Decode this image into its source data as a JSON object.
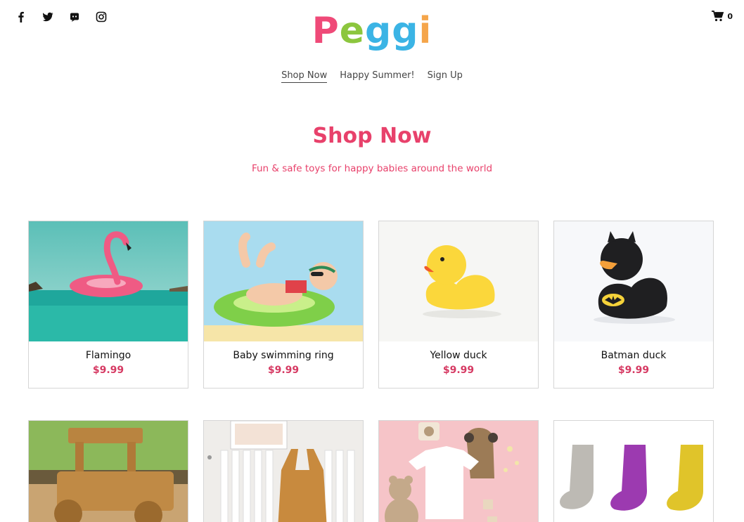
{
  "header": {
    "social_icons": [
      "facebook-icon",
      "twitter-icon",
      "discord-icon",
      "instagram-icon"
    ],
    "logo_letters": [
      {
        "char": "P",
        "color": "#ef4a78"
      },
      {
        "char": "e",
        "color": "#8cc63e"
      },
      {
        "char": "g",
        "color": "#3bb4e5"
      },
      {
        "char": "g",
        "color": "#3bb4e5"
      },
      {
        "char": "i",
        "color": "#f5a54a"
      }
    ],
    "cart_count": "0",
    "cart_icon": "shopping-cart-icon"
  },
  "nav": {
    "items": [
      {
        "label": "Shop Now",
        "active": true
      },
      {
        "label": "Happy Summer!",
        "active": false
      },
      {
        "label": "Sign Up",
        "active": false
      }
    ]
  },
  "hero": {
    "title": "Shop Now",
    "subtitle": "Fun & safe toys for happy babies around the world",
    "accent_color": "#e8416b"
  },
  "products": [
    {
      "name": "Flamingo",
      "price": "$9.99"
    },
    {
      "name": "Baby swimming ring",
      "price": "$9.99"
    },
    {
      "name": "Yellow duck",
      "price": "$9.99"
    },
    {
      "name": "Batman duck",
      "price": "$9.99"
    },
    {
      "name": "",
      "price": ""
    },
    {
      "name": "",
      "price": ""
    },
    {
      "name": "",
      "price": ""
    },
    {
      "name": "",
      "price": ""
    }
  ]
}
